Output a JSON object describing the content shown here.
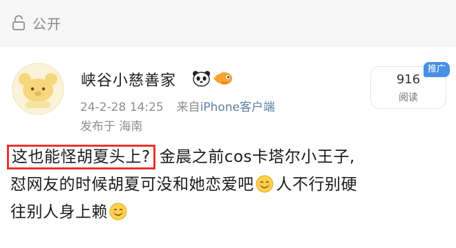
{
  "visibility": {
    "icon": "lock-icon",
    "label": "公开"
  },
  "user": {
    "name": "峡谷小慈善家",
    "avatar": "bear-avatar",
    "name_emojis": [
      "panda-emoji",
      "fish-emoji"
    ]
  },
  "meta": {
    "date": "24-2-28 14:25",
    "source_prefix": "来自",
    "source_name": "iPhone客户端",
    "location": "发布于 海南"
  },
  "stats": {
    "read_count": "916",
    "read_label": "阅读",
    "promote_label": "推广"
  },
  "post": {
    "highlight": "这也能怪胡夏头上?",
    "line1_rest": "金晨之前cos卡塔尔小王子,",
    "line2": "怼网友的时候胡夏可没和她恋爱吧",
    "line2_after": "人不行别硬",
    "line3": "往别人身上赖",
    "emoji": "smiling-face"
  },
  "colors": {
    "highlight_border": "#e8322f",
    "link": "#5b7ea6",
    "badge": "#4a90e2"
  }
}
